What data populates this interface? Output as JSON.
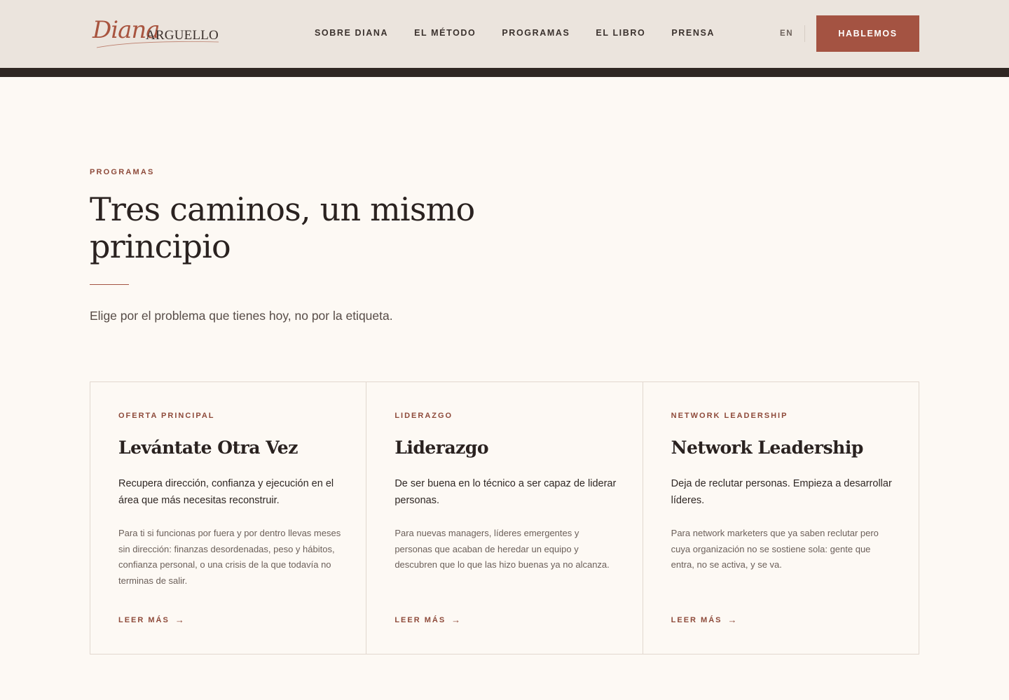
{
  "brand": {
    "logo_script": "Diana",
    "logo_caps": "ARGUELLO",
    "accent_color": "#a45342",
    "dark_color": "#2f2723"
  },
  "nav": {
    "items": [
      {
        "label": "SOBRE DIANA"
      },
      {
        "label": "EL MÉTODO"
      },
      {
        "label": "PROGRAMAS"
      },
      {
        "label": "EL LIBRO"
      },
      {
        "label": "PRENSA"
      }
    ],
    "lang": "EN",
    "cta": "HABLEMOS"
  },
  "section": {
    "eyebrow": "PROGRAMAS",
    "title": "Tres caminos, un mismo principio",
    "intro": "Elige por el problema que tienes hoy, no por la etiqueta."
  },
  "cards": [
    {
      "tag": "OFERTA PRINCIPAL",
      "name": "Levántate Otra Vez",
      "lead": "Recupera dirección, confianza y ejecución en el área que más necesitas reconstruir.",
      "desc": "Para ti si funcionas por fuera y por dentro llevas meses sin dirección: finanzas desordenadas, peso y hábitos, confianza personal, o una crisis de la que todavía no terminas de salir.",
      "more": "LEER MÁS",
      "arrow_icon": "arrow-right-icon"
    },
    {
      "tag": "LIDERAZGO",
      "name": "Liderazgo",
      "lead": "De ser buena en lo técnico a ser capaz de liderar personas.",
      "desc": "Para nuevas managers, líderes emergentes y personas que acaban de heredar un equipo y descubren que lo que las hizo buenas ya no alcanza.",
      "more": "LEER MÁS",
      "arrow_icon": "arrow-right-icon"
    },
    {
      "tag": "NETWORK LEADERSHIP",
      "name": "Network Leadership",
      "lead": "Deja de reclutar personas. Empieza a desarrollar líderes.",
      "desc": "Para network marketers que ya saben reclutar pero cuya organización no se sostiene sola: gente que entra, no se activa, y se va.",
      "more": "LEER MÁS",
      "arrow_icon": "arrow-right-icon"
    }
  ]
}
